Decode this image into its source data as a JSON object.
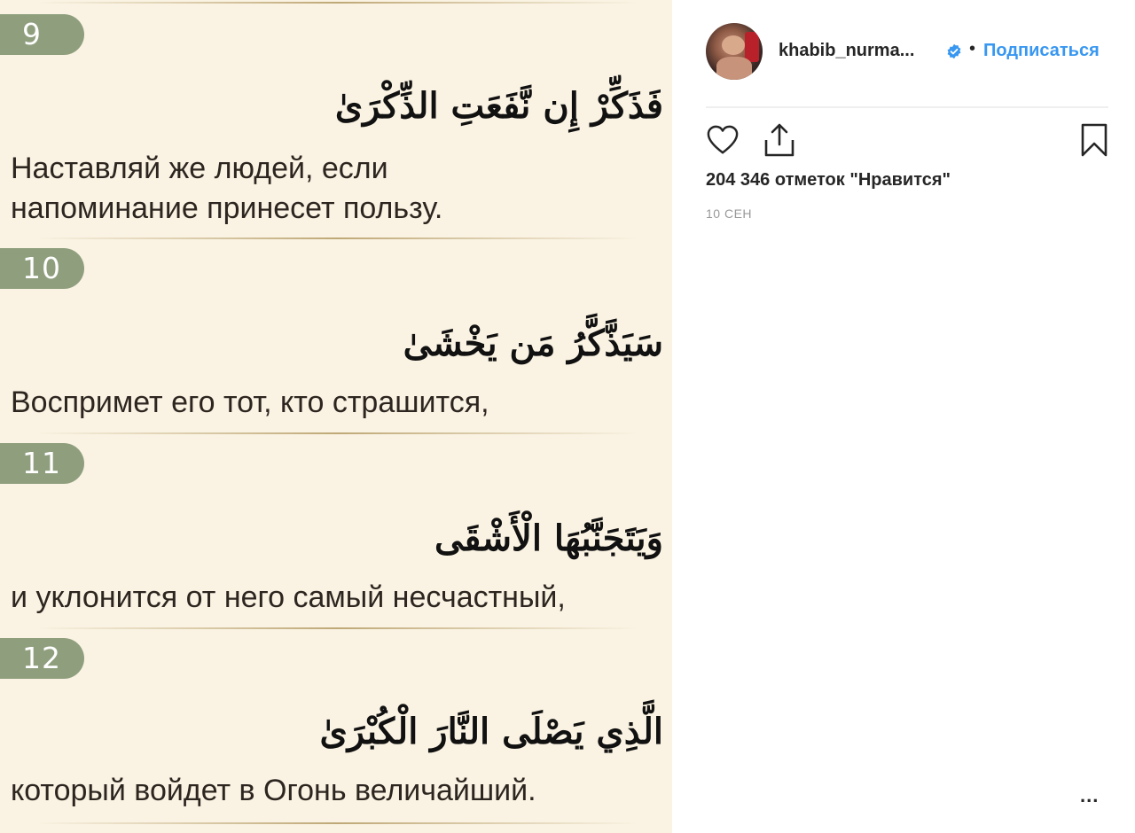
{
  "verses": [
    {
      "number": "9",
      "arabic": "فَذَكِّرْ إِن نَّفَعَتِ الذِّكْرَىٰ",
      "ru": [
        "Наставляй же людей, если",
        "напоминание принесет пользу."
      ]
    },
    {
      "number": "10",
      "arabic": "سَيَذَّكَّرُ مَن يَخْشَىٰ",
      "ru": [
        "Воспримет его тот, кто страшится,"
      ]
    },
    {
      "number": "11",
      "arabic": "وَيَتَجَنَّبُهَا الْأَشْقَى",
      "ru": [
        "и уклонится от него самый несчастный,"
      ]
    },
    {
      "number": "12",
      "arabic": "الَّذِي يَصْلَى النَّارَ الْكُبْرَىٰ",
      "ru": [
        "который войдет в Огонь величайший."
      ]
    }
  ],
  "header": {
    "username": "khabib_nurma...",
    "separator": "•",
    "follow_label": "Подписаться"
  },
  "actions": {
    "like_icon": "heart-icon",
    "share_icon": "share-icon",
    "save_icon": "bookmark-icon"
  },
  "likes_text": "204 346 отметок \"Нравится\"",
  "date": "10 СЕН",
  "more_label": "...",
  "colors": {
    "badge": "#8f9f7e",
    "page_bg": "#faf3e3",
    "link": "#3897f0",
    "verified": "#3897f0"
  }
}
